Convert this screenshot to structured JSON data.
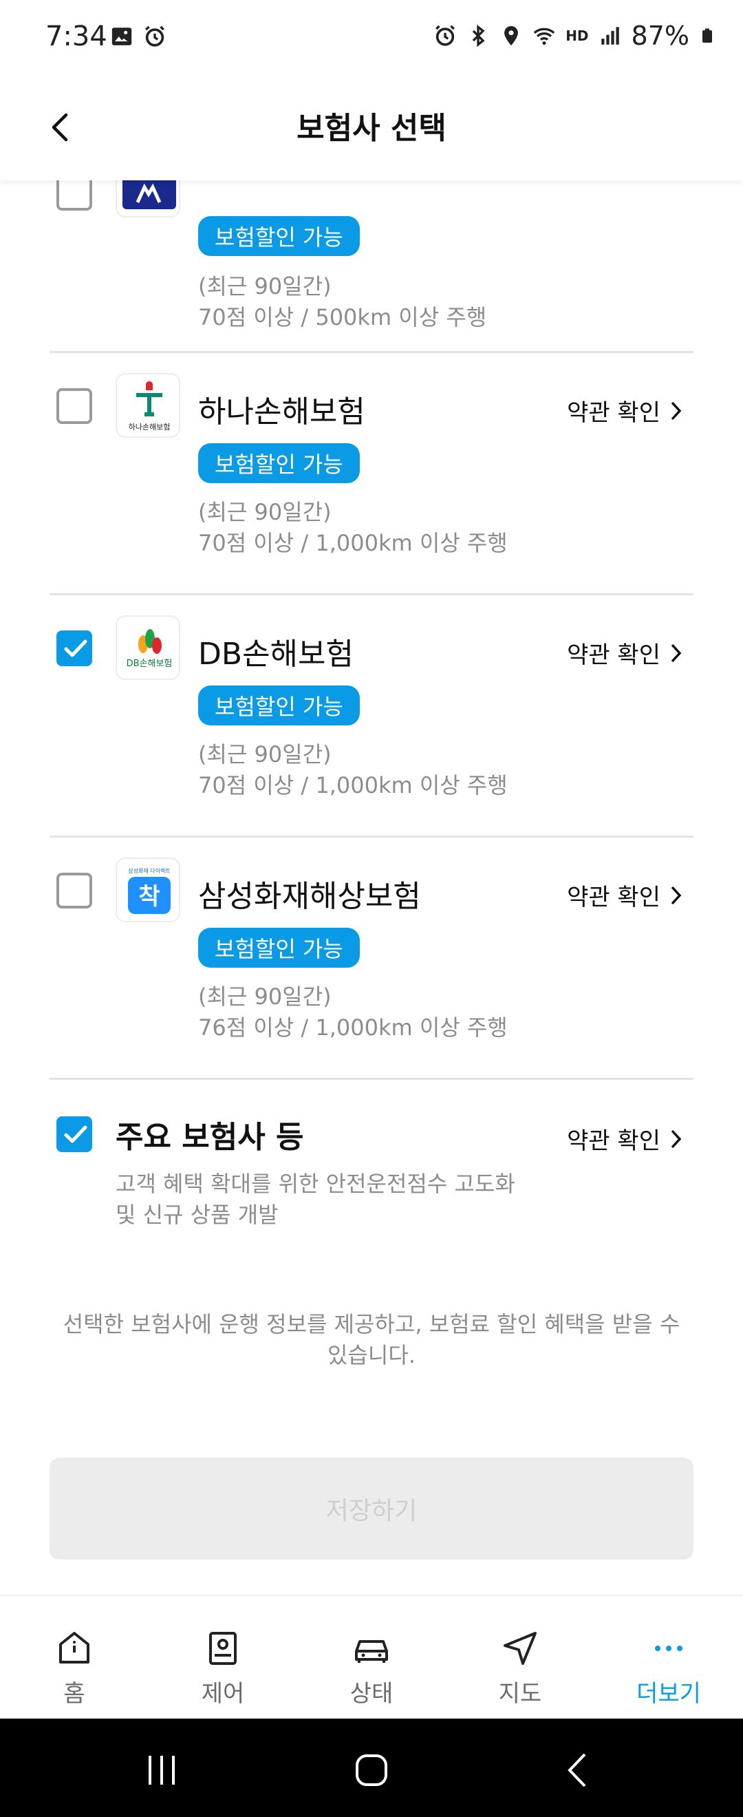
{
  "status_bar": {
    "time": "7:34",
    "battery": "87%",
    "hd_label": "HD"
  },
  "header": {
    "title": "보험사 선택"
  },
  "insurers": [
    {
      "name": "",
      "checked": false,
      "badge": "보험할인 가능",
      "cond_period": "(최근 90일간)",
      "cond_detail": "70점 이상 / 500km 이상 주행",
      "logo": "partial-insurer-logo"
    },
    {
      "name": "하나손해보험",
      "checked": false,
      "terms": "약관 확인",
      "badge": "보험할인 가능",
      "cond_period": "(최근 90일간)",
      "cond_detail": "70점 이상 / 1,000km 이상 주행",
      "logo_text": "하나손해보험"
    },
    {
      "name": "DB손해보험",
      "checked": true,
      "terms": "약관 확인",
      "badge": "보험할인 가능",
      "cond_period": "(최근 90일간)",
      "cond_detail": "70점 이상 / 1,000km 이상 주행",
      "logo_text": "DB손해보험"
    },
    {
      "name": "삼성화재해상보험",
      "checked": false,
      "terms": "약관 확인",
      "badge": "보험할인 가능",
      "cond_period": "(최근 90일간)",
      "cond_detail": "76점 이상 / 1,000km 이상 주행",
      "logo_text": "착",
      "logo_subtext": "삼성화재 다이렉트"
    }
  ],
  "major": {
    "label": "주요 보험사 등",
    "checked": true,
    "terms": "약관 확인",
    "desc_line1": "고객 혜택 확대를 위한 안전운전점수 고도화",
    "desc_line2": "및 신규 상품 개발"
  },
  "notice": {
    "line1": "선택한 보험사에 운행 정보를 제공하고, 보험료 할인 혜택을 받을 수",
    "line2": "있습니다."
  },
  "save_button": "저장하기",
  "bottom_nav": [
    {
      "label": "홈",
      "icon": "home-icon",
      "active": false
    },
    {
      "label": "제어",
      "icon": "remote-icon",
      "active": false
    },
    {
      "label": "상태",
      "icon": "car-icon",
      "active": false
    },
    {
      "label": "지도",
      "icon": "navigation-icon",
      "active": false
    },
    {
      "label": "더보기",
      "icon": "more-icon",
      "active": true
    }
  ],
  "colors": {
    "accent": "#0a9ae6",
    "muted_text": "#8c8c8c",
    "divider": "#e3e3e3"
  }
}
